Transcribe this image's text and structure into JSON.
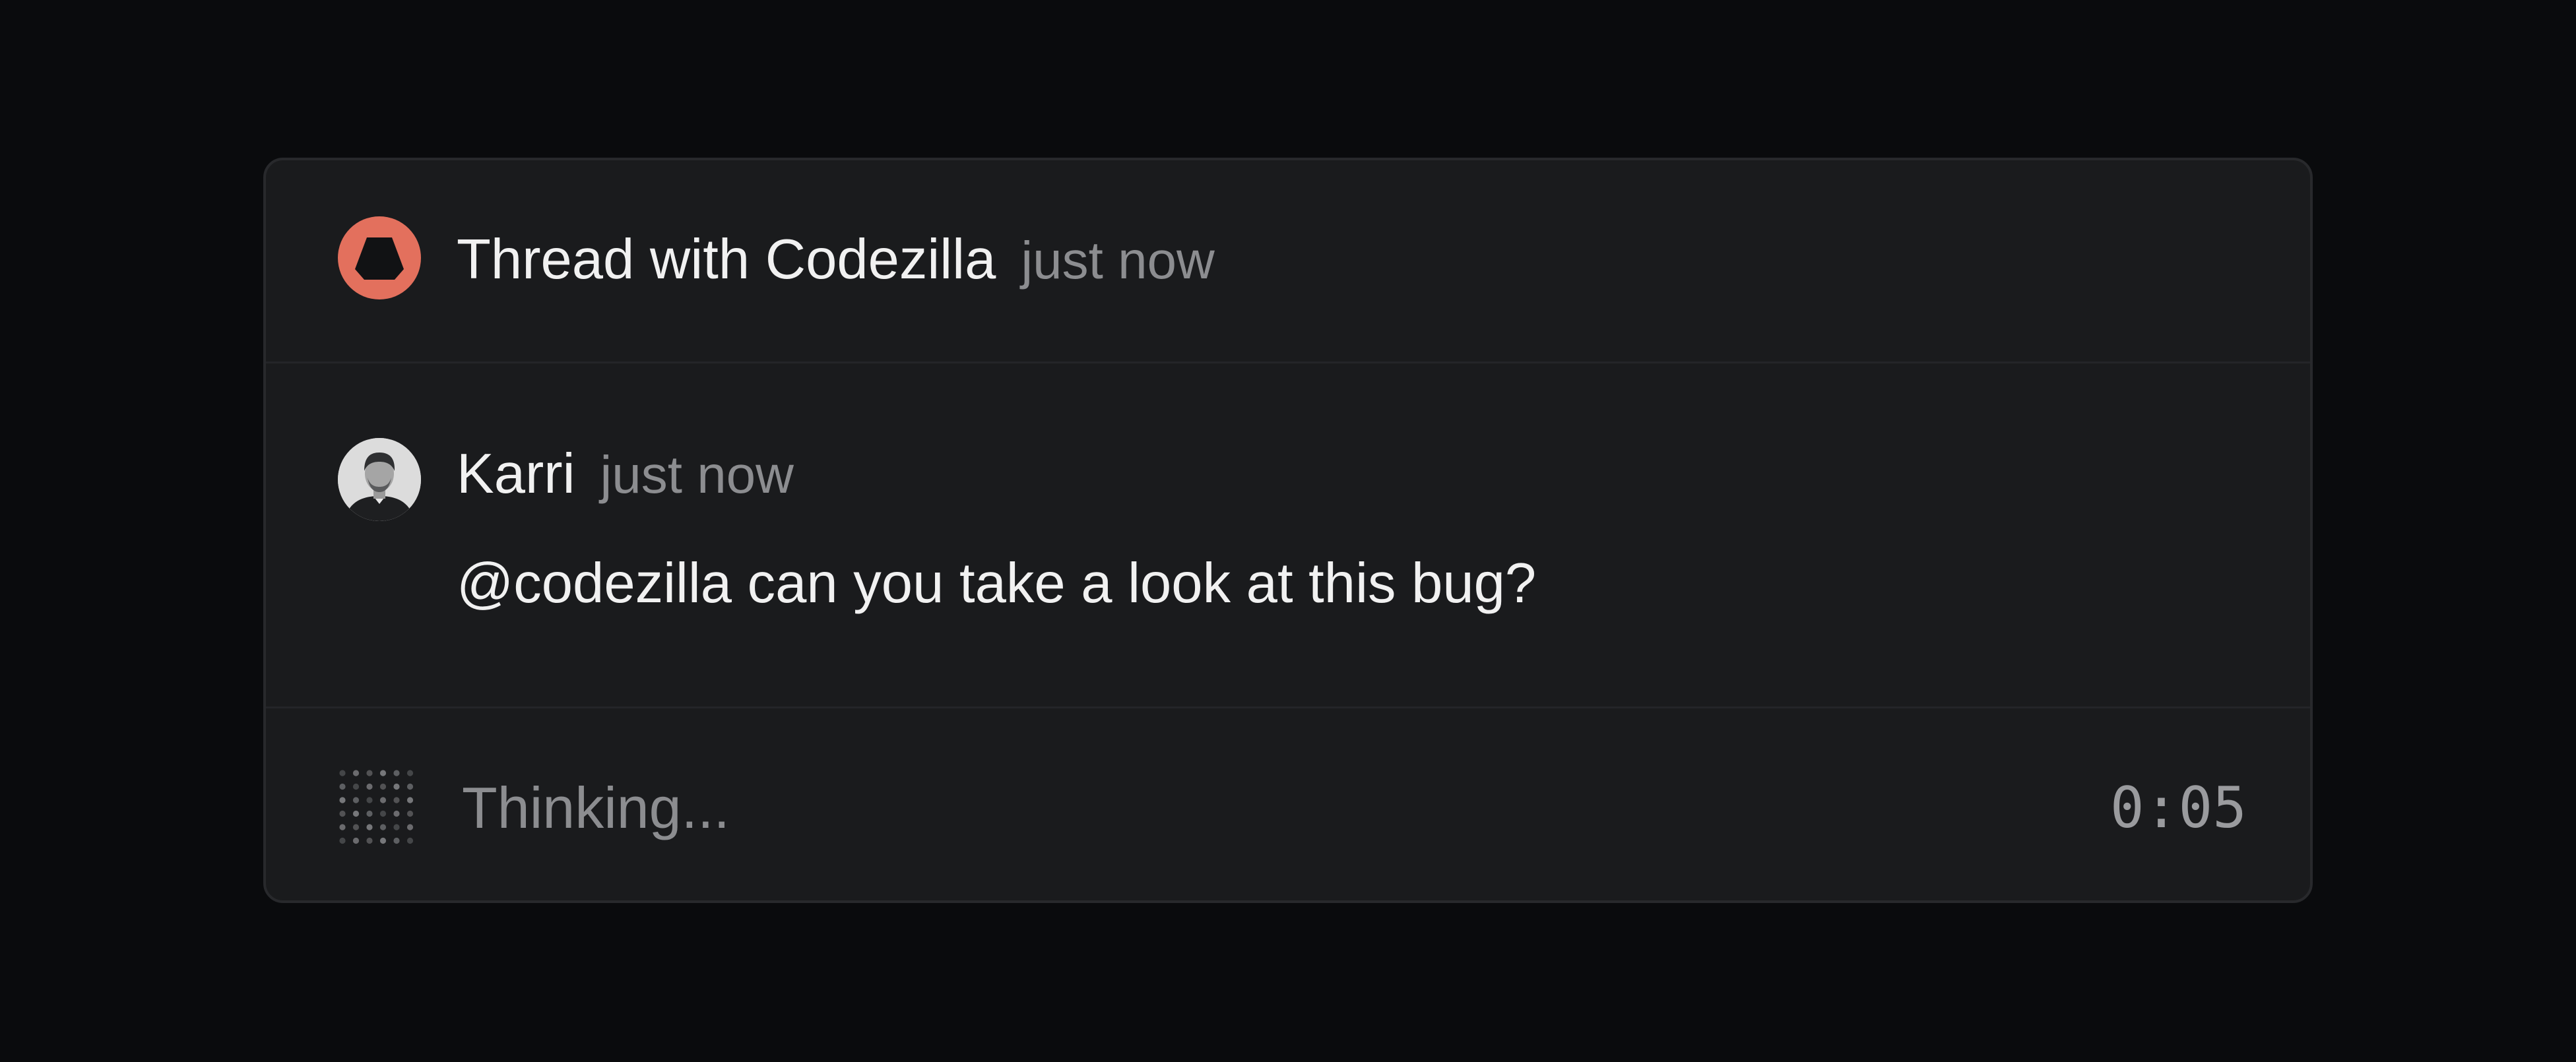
{
  "thread": {
    "title": "Thread with Codezilla",
    "timestamp": "just now",
    "bot_icon": "codezilla-logo-icon",
    "accent_color": "#e3705d"
  },
  "message": {
    "author": "Karri",
    "timestamp": "just now",
    "avatar_icon": "user-avatar-photo",
    "text": "@codezilla can you take a look at this bug?"
  },
  "status": {
    "label": "Thinking...",
    "elapsed": "0:05",
    "indicator_icon": "loading-dots-icon"
  }
}
